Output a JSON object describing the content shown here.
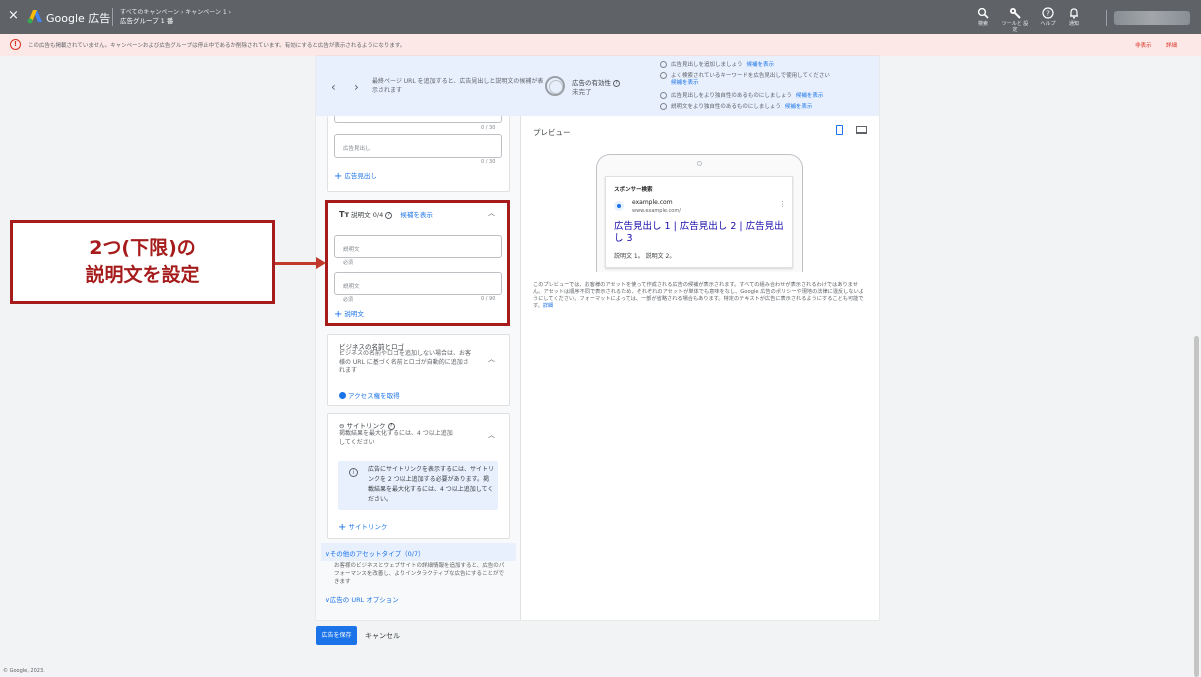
{
  "topbar": {
    "close": "×",
    "brand": "Google 広告",
    "breadcrumb_top": "すべてのキャンペーン  ›  キャンペーン 1  ›",
    "breadcrumb_current": "広告グループ 1 番",
    "tools": [
      {
        "label": "検索",
        "icon": "search-icon"
      },
      {
        "label": "ツールと 設定",
        "icon": "wrench-icon"
      },
      {
        "label": "ヘルプ",
        "icon": "help-icon"
      },
      {
        "label": "通知",
        "icon": "bell-icon"
      }
    ]
  },
  "banner": {
    "message": "この広告も掲載されていません。キャンペーンおよび広告グループは停止中であるか削除されています。有効にすると広告が表示されるようになります。",
    "hide": "非表示",
    "details": "詳細"
  },
  "stepbar": {
    "hint": "最終ページ URL を追加すると、広告見出しと説明文の候補が表示されます",
    "effectiveness_label": "広告の有効性",
    "effectiveness_value": "未完了",
    "suggestions": [
      {
        "text": "広告見出しを追加しましょう",
        "link": "候補を表示",
        "sub": ""
      },
      {
        "text": "よく検索されているキーワードを広告見出しで使用してください",
        "link": "",
        "sub": "候補を表示"
      },
      {
        "text": "広告見出しをより独自性のあるものにしましょう",
        "link": "候補を表示",
        "sub": ""
      },
      {
        "text": "説明文をより独自性のあるものにしましょう",
        "link": "候補を表示",
        "sub": ""
      }
    ]
  },
  "headlines": {
    "counter_1": "0 / 30",
    "placeholder": "広告見出し",
    "counter_2": "0 / 30",
    "add": "広告見出し"
  },
  "descriptions": {
    "title": "説明文",
    "count": "0/4",
    "suggest_link": "候補を表示",
    "placeholder_1": "説明文",
    "required_1": "必須",
    "placeholder_2": "説明文",
    "required_2": "必須",
    "counter": "0 / 90",
    "add": "説明文"
  },
  "business": {
    "title": "ビジネスの名前とロゴ",
    "desc": "ビジネスの名前やロゴを追加しない場合は、お客様の URL に基づく名前とロゴが自動的に追加されます",
    "link": "アクセス権を取得"
  },
  "sitelinks": {
    "title": "サイトリンク",
    "desc": "掲載結果を最大化するには、4 つ以上追加してください",
    "info": "広告にサイトリンクを表示するには、サイトリンクを 2 つ以上追加する必要があります。掲載結果を最大化するには、4 つ以上追加してください。",
    "add": "サイトリンク"
  },
  "other_assets": {
    "title": "その他のアセットタイプ（0/7）",
    "desc": "お客様のビジネスとウェブサイトの詳細情報を追加すると、広告のパフォーマンスを改善し、よりインタラクティブな広告にすることができます"
  },
  "url_options": "広告の URL オプション",
  "preview": {
    "title": "プレビュー",
    "sponsored": "スポンサー検索",
    "domain": "example.com",
    "url": "www.example.com/",
    "headline": "広告見出し 1 | 広告見出し 2 | 広告見出し 3",
    "body": "説明文 1。 説明文 2。",
    "disclaimer": "このプレビューでは、お客様のアセットを使って作成される広告の候補が表示されます。すべての組み合わせが表示されるわけではありません。アセットは順序不同で表示されるため、それぞれのアセットが単体でも意味をなし、Google 広告のポリシーや現地の法律に違反しないようにしてください。フォーマットによっては、一部が省略される場合もあります。特定のテキストが広告に表示されるようにすることも可能です。",
    "disclaimer_link": "詳細"
  },
  "actions": {
    "save": "広告を保存",
    "cancel": "キャンセル"
  },
  "copyright": "© Google, 2023.",
  "annotation": {
    "line1": "2つ(下限)の",
    "line2": "説明文を設定"
  }
}
